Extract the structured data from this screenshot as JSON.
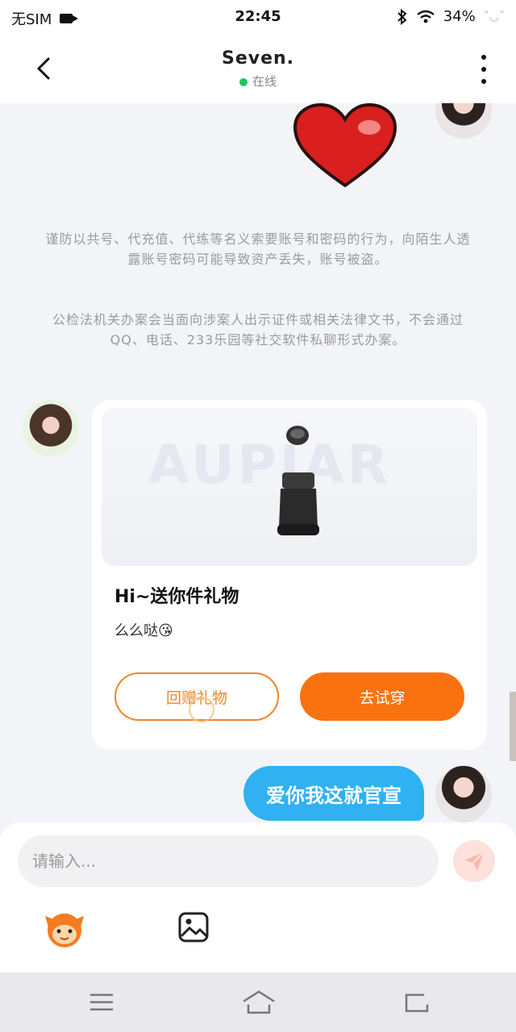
{
  "status": {
    "carrier": "无SIM",
    "time": "22:45",
    "battery": "34%"
  },
  "header": {
    "title": "Seven.",
    "status": "在线"
  },
  "notice": {
    "paragraph1": "谨防以共号、代充值、代练等名义索要账号和密码的行为，向陌生人透露账号密码可能导致资产丢失，账号被盗。",
    "paragraph2": "公检法机关办案会当面向涉案人出示证件或相关法律文书，不会通过QQ、电话、233乐园等社交软件私聊形式办案。"
  },
  "gift_card": {
    "watermark_line1": "AUPIAR",
    "title": "Hi~送你件礼物",
    "subtitle": "么么哒😘",
    "return_gift_label": "回赠礼物",
    "try_on_label": "去试穿"
  },
  "message": {
    "text": "爱你我这就官宣"
  },
  "input": {
    "placeholder": "请输入..."
  },
  "icons": {
    "back": "chevron-left-icon",
    "more": "more-vertical-icon",
    "send": "send-icon",
    "image": "image-icon",
    "mascot": "mascot-icon"
  },
  "colors": {
    "accent_orange": "#fa720f",
    "bubble_blue": "#2fb1f2",
    "online_green": "#22c55e"
  }
}
